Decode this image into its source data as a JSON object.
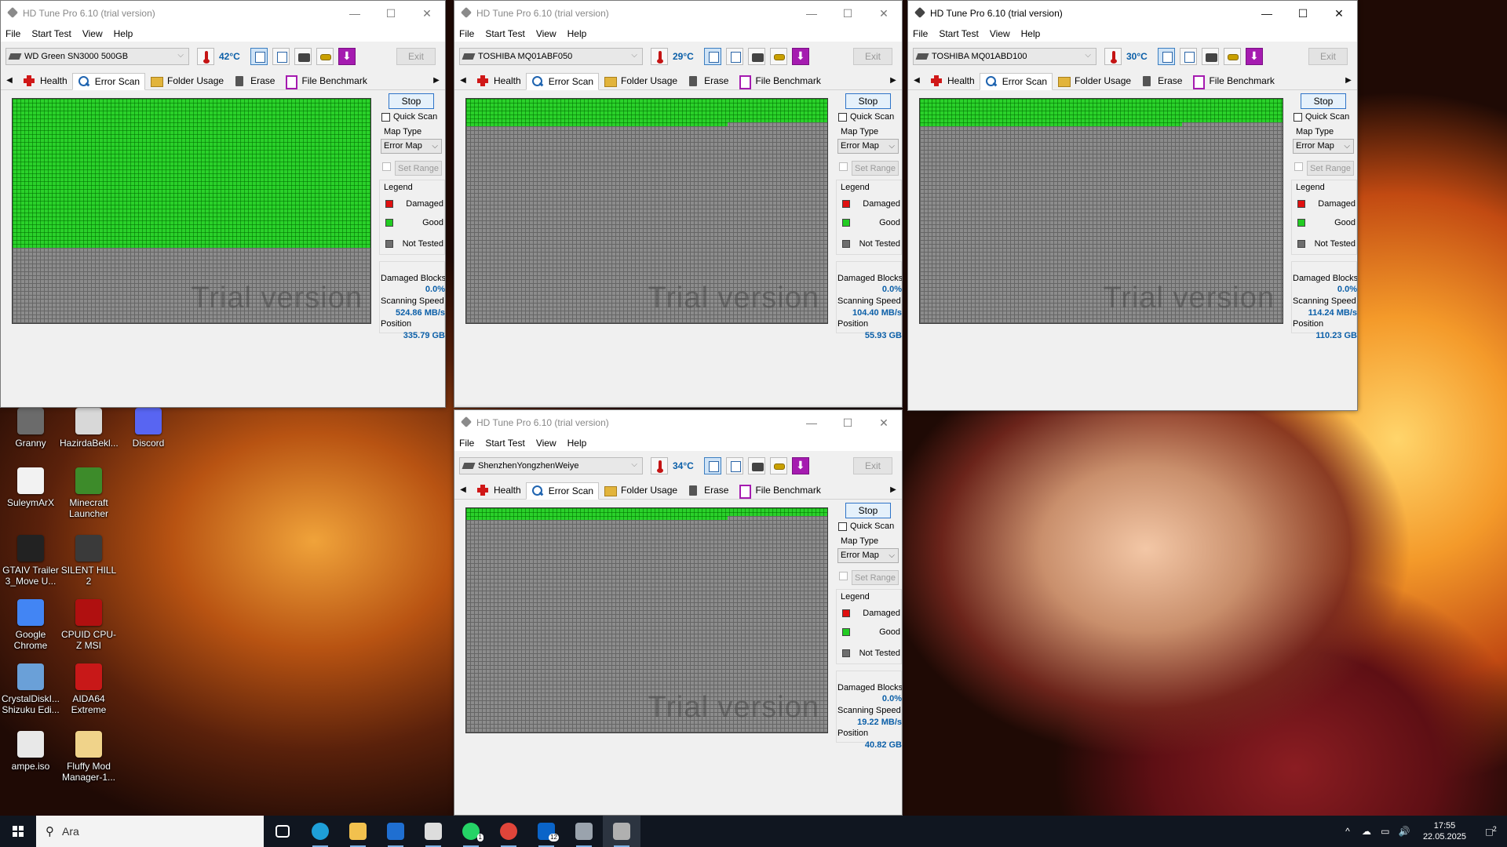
{
  "app": {
    "window_title": "HD Tune Pro 6.10 (trial version)",
    "menu": [
      "File",
      "Start Test",
      "View",
      "Help"
    ],
    "exit_label": "Exit",
    "tabs": [
      "Health",
      "Error Scan",
      "Folder Usage",
      "Erase",
      "File Benchmark"
    ],
    "stop_label": "Stop",
    "quick_scan_label": "Quick Scan",
    "map_type_label": "Map Type",
    "map_type_value": "Error Map",
    "set_range_label": "Set Range",
    "legend_title": "Legend",
    "legend": [
      {
        "label": "Damaged",
        "color": "#e01010"
      },
      {
        "label": "Good",
        "color": "#22cc22"
      },
      {
        "label": "Not Tested",
        "color": "#6e6e6e"
      }
    ],
    "damaged_blocks_label": "Damaged Blocks",
    "scanning_speed_label": "Scanning Speed",
    "position_label": "Position",
    "watermark": "Trial version",
    "min_icon": "minimize-icon",
    "max_icon": "maximize-icon",
    "close_icon": "close-icon"
  },
  "windows": [
    {
      "drive": "WD Green SN3000 500GB",
      "temperature": "42°C",
      "damaged_blocks": "0.0%",
      "scanning_speed": "524.86 MB/s",
      "position": "335.79 GB",
      "scan_progress_fraction": 0.68,
      "active": false
    },
    {
      "drive": "TOSHIBA MQ01ABF050",
      "temperature": "29°C",
      "damaged_blocks": "0.0%",
      "scanning_speed": "104.40 MB/s",
      "position": "55.93 GB",
      "scan_progress_fraction": 0.11,
      "active": false
    },
    {
      "drive": "TOSHIBA MQ01ABD100",
      "temperature": "30°C",
      "damaged_blocks": "0.0%",
      "scanning_speed": "114.24 MB/s",
      "position": "110.23 GB",
      "scan_progress_fraction": 0.11,
      "active": true
    },
    {
      "drive": "ShenzhenYongzhenWeiye",
      "temperature": "34°C",
      "damaged_blocks": "0.0%",
      "scanning_speed": "19.22 MB/s",
      "position": "40.82 GB",
      "scan_progress_fraction": 0.04,
      "active": false
    }
  ],
  "desktop_icons": [
    {
      "label": "Granny",
      "color": "#6b6b6b"
    },
    {
      "label": "HazirdaBekl...",
      "color": "#d8d8d8"
    },
    {
      "label": "Discord",
      "color": "#5865f2"
    },
    {
      "label": "SuleymArX",
      "color": "#f2f2f2"
    },
    {
      "label": "Minecraft Launcher",
      "color": "#3d8b2a"
    },
    {
      "label": "GTAIV Trailer 3_Move U...",
      "color": "#222222"
    },
    {
      "label": "SILENT HILL 2",
      "color": "#3a3a3a"
    },
    {
      "label": "Google Chrome",
      "color": "#4285f4"
    },
    {
      "label": "CPUID CPU-Z MSI",
      "color": "#b01010"
    },
    {
      "label": "CrystalDiskI... Shizuku Edi...",
      "color": "#6aa0d8"
    },
    {
      "label": "AIDA64 Extreme",
      "color": "#c81818"
    },
    {
      "label": "ampe.iso",
      "color": "#e8e8e8"
    },
    {
      "label": "Fluffy Mod Manager-1...",
      "color": "#f0d38a"
    }
  ],
  "taskbar": {
    "search_placeholder": "Ara",
    "apps": [
      {
        "name": "task-view-icon",
        "color": "#ffffff"
      },
      {
        "name": "edge-icon",
        "color": "#1e9fd8"
      },
      {
        "name": "file-explorer-icon",
        "color": "#f2c14e"
      },
      {
        "name": "mail-icon",
        "color": "#1f6fd1"
      },
      {
        "name": "store-icon",
        "color": "#dddddd"
      },
      {
        "name": "whatsapp-icon",
        "color": "#25d366",
        "badge": "1"
      },
      {
        "name": "chrome-icon",
        "color": "#e0453a"
      },
      {
        "name": "outlook-icon",
        "color": "#0a64c8",
        "badge": "12"
      },
      {
        "name": "monitor-app-icon",
        "color": "#9aa3ad"
      },
      {
        "name": "hdtune-icon",
        "color": "#b0b0b0"
      }
    ],
    "tray_chevron": "^",
    "time": "17:55",
    "date": "22.05.2025",
    "notification_badge": "2"
  }
}
